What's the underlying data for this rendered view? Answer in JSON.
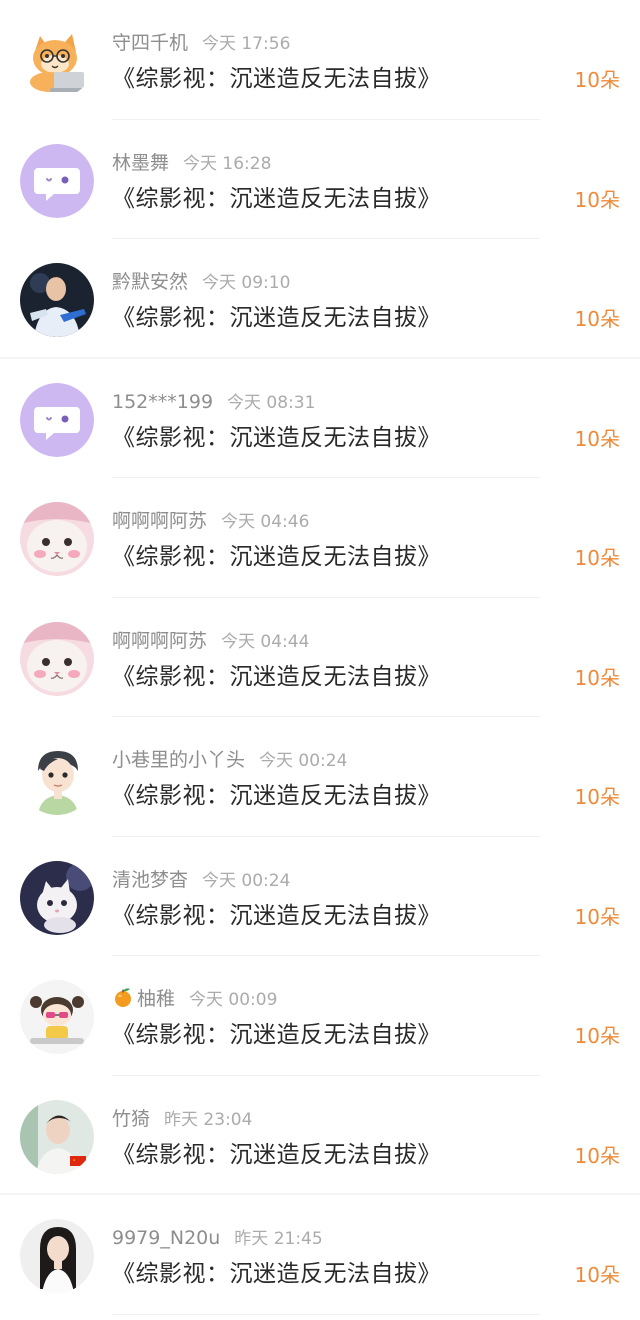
{
  "gifts": [
    {
      "name": "守四千机",
      "time": "今天 17:56",
      "book": "《综影视：沉迷造反无法自拔》",
      "count": "10朵",
      "avatar": "cartoon-cat-laptop-avatar"
    },
    {
      "name": "林墨舞",
      "time": "今天 16:28",
      "book": "《综影视：沉迷造反无法自拔》",
      "count": "10朵",
      "avatar": "default-chat-bubble-avatar"
    },
    {
      "name": "黔默安然",
      "time": "今天 09:10",
      "book": "《综影视：沉迷造反无法自拔》",
      "count": "10朵",
      "avatar": "person-photo-avatar"
    },
    {
      "name": "152***199",
      "time": "今天 08:31",
      "book": "《综影视：沉迷造反无法自拔》",
      "count": "10朵",
      "avatar": "default-chat-bubble-avatar"
    },
    {
      "name": "啊啊啊阿苏",
      "time": "今天 04:46",
      "book": "《综影视：沉迷造反无法自拔》",
      "count": "10朵",
      "avatar": "pink-cat-avatar"
    },
    {
      "name": "啊啊啊阿苏",
      "time": "今天 04:44",
      "book": "《综影视：沉迷造反无法自拔》",
      "count": "10朵",
      "avatar": "pink-cat-avatar"
    },
    {
      "name": "小巷里的小丫头",
      "time": "今天 00:24",
      "book": "《综影视：沉迷造反无法自拔》",
      "count": "10朵",
      "avatar": "cartoon-boy-avatar"
    },
    {
      "name": "清池梦杳",
      "time": "今天 00:24",
      "book": "《综影视：沉迷造反无法自拔》",
      "count": "10朵",
      "avatar": "white-cat-avatar"
    },
    {
      "name": "柚稚",
      "time": "今天 00:09",
      "book": "《综影视：沉迷造反无法自拔》",
      "count": "10朵",
      "avatar": "cartoon-girl-avatar",
      "name_prefix_icon": "orange-emoji-icon"
    },
    {
      "name": "竹猗",
      "time": "昨天 23:04",
      "book": "《综影视：沉迷造反无法自拔》",
      "count": "10朵",
      "avatar": "man-photo-avatar"
    },
    {
      "name": "9979_N20u",
      "time": "昨天 21:45",
      "book": "《综影视：沉迷造反无法自拔》",
      "count": "10朵",
      "avatar": "woman-photo-avatar"
    }
  ],
  "colors": {
    "count_orange": "#ee8a3a",
    "name_gray": "#8e8e8e",
    "time_gray": "#ababab",
    "default_avatar_purple": "#cdb8f1"
  }
}
